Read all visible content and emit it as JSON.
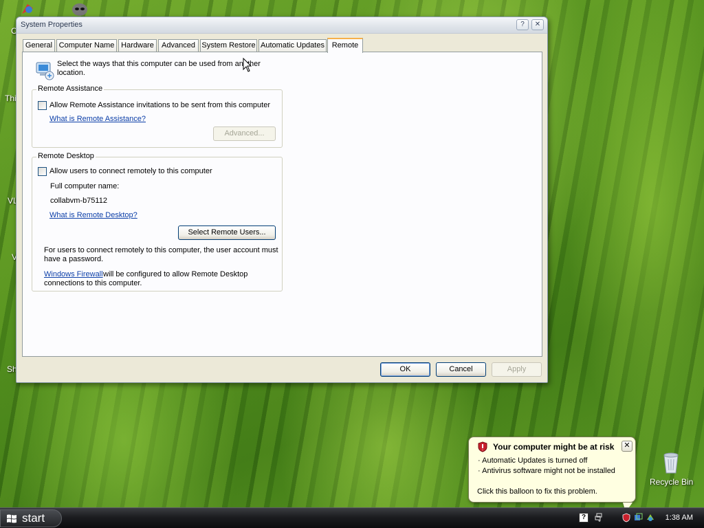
{
  "desktop": {
    "fragments": [
      "C",
      "Thi",
      "VL",
      "V",
      "Sh"
    ],
    "recycle_bin_label": "Recycle Bin"
  },
  "dialog": {
    "title": "System Properties",
    "help_button": "?",
    "close_button": "✕",
    "tabs": [
      "General",
      "Computer Name",
      "Hardware",
      "Advanced",
      "System Restore",
      "Automatic Updates",
      "Remote"
    ],
    "active_tab": "Remote",
    "intro_text_line1": "Select the ways that this computer can be used from another",
    "intro_text_line2": "location.",
    "remote_assistance": {
      "label": "Remote Assistance",
      "checkbox_label": "Allow Remote Assistance invitations to be sent from this computer",
      "checked": false,
      "link": "What is Remote Assistance?",
      "advanced_button": "Advanced..."
    },
    "remote_desktop": {
      "label": "Remote Desktop",
      "checkbox_label": "Allow users to connect remotely to this computer",
      "checked": false,
      "full_name_label": "Full computer name:",
      "computer_name": "collabvm-b75112",
      "link": "What is Remote Desktop?",
      "select_users_button": "Select Remote Users...",
      "note_line1": "For users to connect remotely to this computer, the user account must",
      "note_line2": "have a password.",
      "firewall_link": "Windows Firewall",
      "firewall_text_line1": " will be configured to allow Remote Desktop",
      "firewall_text_line2": "connections to this computer."
    },
    "buttons": {
      "ok": "OK",
      "cancel": "Cancel",
      "apply": "Apply"
    }
  },
  "balloon": {
    "title": "Your computer might be at risk",
    "line1": "· Automatic Updates is turned off",
    "line2": "· Antivirus software might not be installed",
    "footer": "Click this balloon to fix this problem.",
    "close": "✕"
  },
  "taskbar": {
    "start_label": "start",
    "clock": "1:38 AM"
  },
  "icons": {
    "remote": "computer-remote-icon",
    "shield": "security-shield-icon",
    "recycle": "recycle-bin-icon",
    "windows": "windows-flag-icon"
  }
}
